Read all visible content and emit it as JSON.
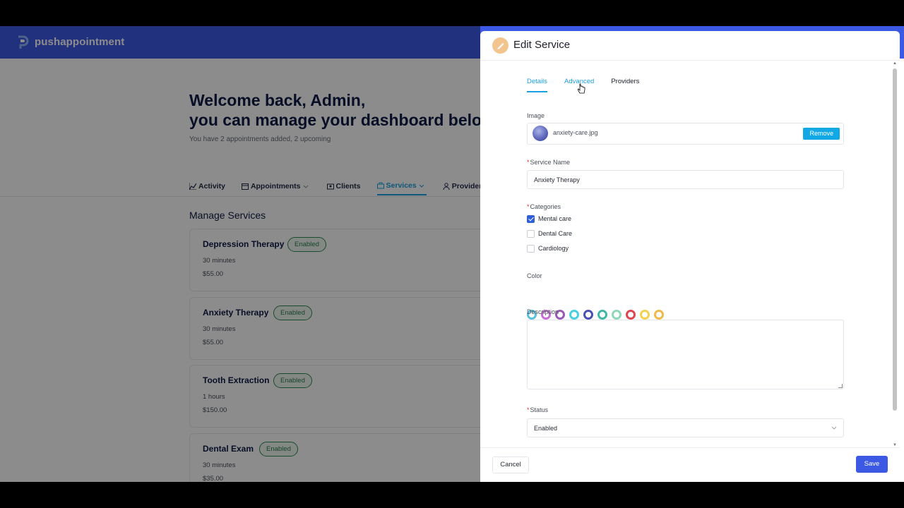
{
  "app": {
    "name": "pushappointment"
  },
  "welcome": {
    "line1": "Welcome back, Admin,",
    "line2": "you can manage your dashboard belo",
    "subtitle": "You have 2 appointments added, 2 upcoming"
  },
  "nav": {
    "tabs": [
      {
        "label": "Activity",
        "icon": "chart-icon"
      },
      {
        "label": "Appointments",
        "icon": "calendar-icon",
        "dropdown": true
      },
      {
        "label": "Clients",
        "icon": "clients-icon"
      },
      {
        "label": "Services",
        "icon": "briefcase-icon",
        "dropdown": true,
        "active": true
      },
      {
        "label": "Providers",
        "icon": "user-icon"
      }
    ]
  },
  "services": {
    "title": "Manage Services",
    "items": [
      {
        "name": "Depression Therapy",
        "status": "Enabled",
        "duration": "30 minutes",
        "price": "$55.00"
      },
      {
        "name": "Anxiety Therapy",
        "status": "Enabled",
        "duration": "30 minutes",
        "price": "$55.00"
      },
      {
        "name": "Tooth Extraction",
        "status": "Enabled",
        "duration": "1 hours",
        "price": "$150.00"
      },
      {
        "name": "Dental Exam",
        "status": "Enabled",
        "duration": "30 minutes",
        "price": "$35.00"
      }
    ]
  },
  "drawer": {
    "title": "Edit Service",
    "tabs": [
      "Details",
      "Advanced",
      "Providers"
    ],
    "active_tab": "Details",
    "image": {
      "label": "Image",
      "filename": "anxiety-care.jpg",
      "remove_label": "Remove"
    },
    "service_name": {
      "label": "Service Name",
      "required_mark": "*",
      "value": "Anxiety Therapy"
    },
    "categories": {
      "label": "Categories",
      "required_mark": "*",
      "options": [
        {
          "label": "Mental care",
          "checked": true
        },
        {
          "label": "Dental Care",
          "checked": false
        },
        {
          "label": "Cardiology",
          "checked": false
        }
      ]
    },
    "color": {
      "label": "Color",
      "swatches": [
        "#5bc0de",
        "#c86dd7",
        "#9b59b6",
        "#48d1e0",
        "#4a4fb5",
        "#3fb8a8",
        "#8fd8b8",
        "#e0454f",
        "#f2d24b",
        "#f0b94a"
      ]
    },
    "description": {
      "label": "Description",
      "value": ""
    },
    "status": {
      "label": "Status",
      "required_mark": "*",
      "value": "Enabled"
    },
    "cancel_label": "Cancel",
    "save_label": "Save"
  },
  "colors": {
    "brand": "#3c59e4",
    "accent": "#1aa0e0",
    "enabled": "#2e7d4f"
  }
}
